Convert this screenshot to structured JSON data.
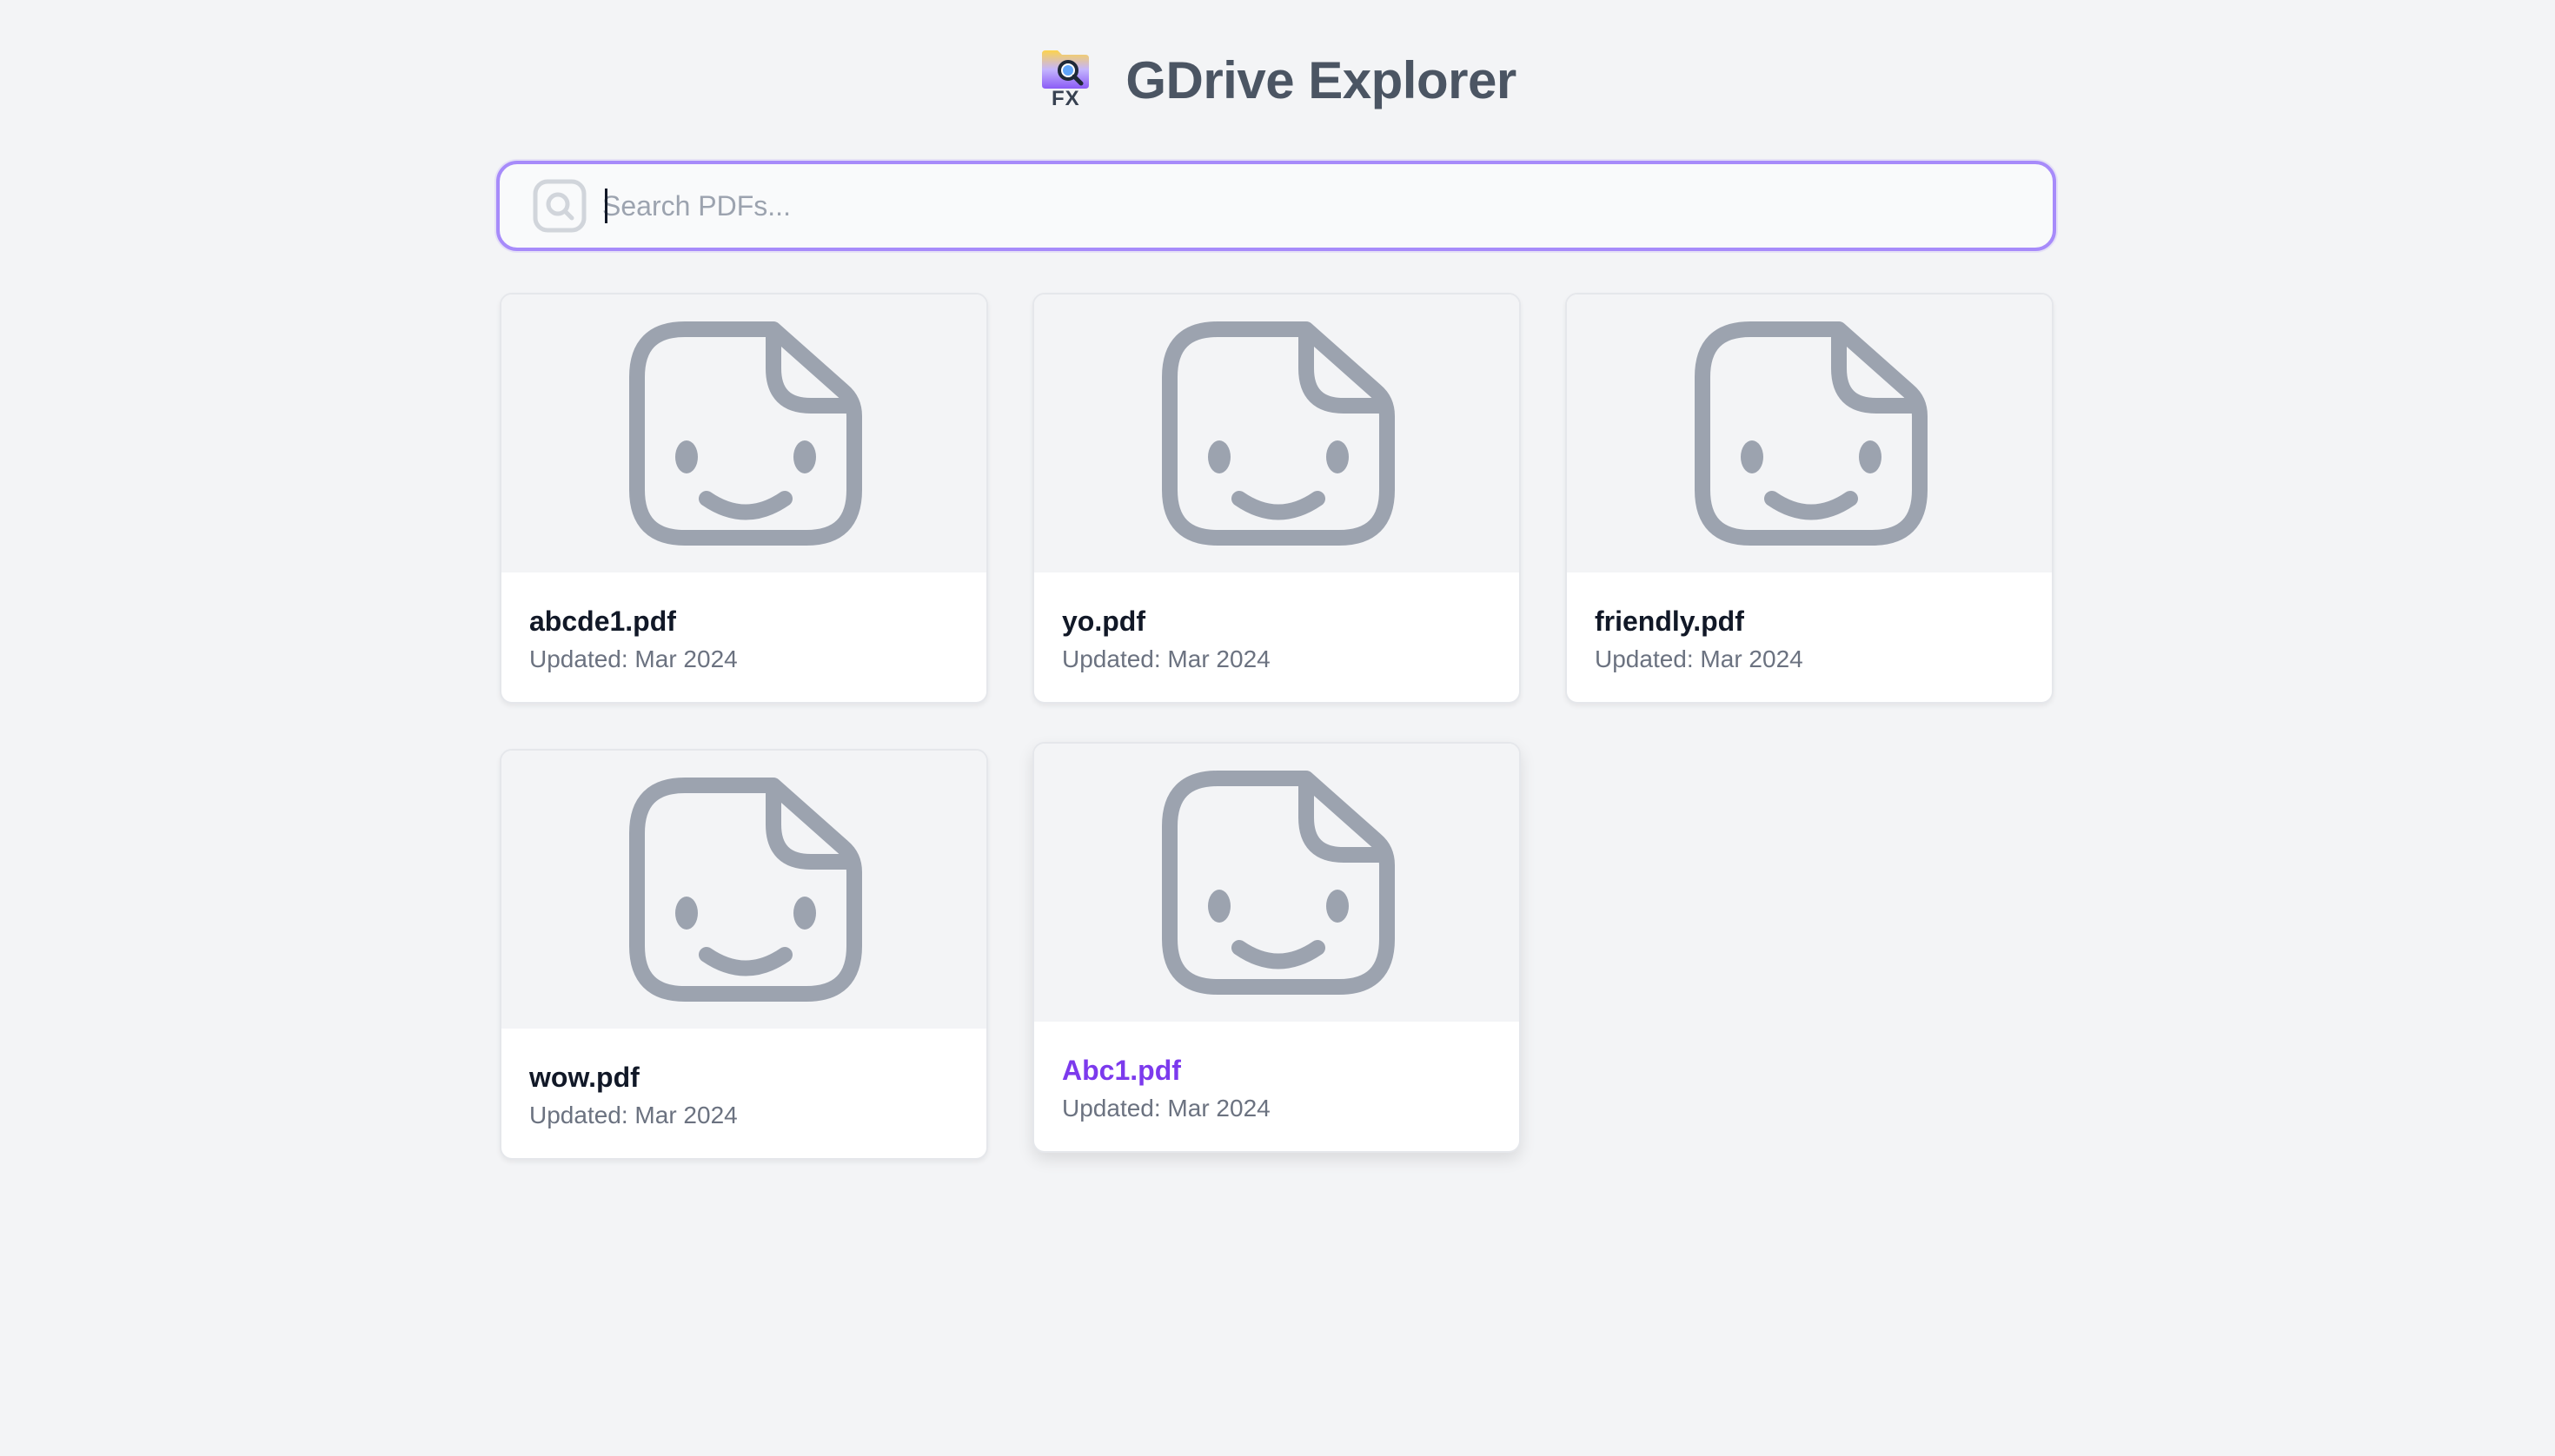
{
  "app": {
    "title": "GDrive Explorer",
    "logo_text": "FX",
    "logo_icon": "folder-magnifier-icon"
  },
  "search": {
    "placeholder": "Search PDFs...",
    "value": "",
    "icon": "search-icon"
  },
  "files": [
    {
      "name": "abcde1.pdf",
      "updated": "Updated: Mar 2024",
      "icon": "file-smile-icon"
    },
    {
      "name": "yo.pdf",
      "updated": "Updated: Mar 2024",
      "icon": "file-smile-icon"
    },
    {
      "name": "friendly.pdf",
      "updated": "Updated: Mar 2024",
      "icon": "file-smile-icon"
    },
    {
      "name": "wow.pdf",
      "updated": "Updated: Mar 2024",
      "icon": "file-smile-icon"
    },
    {
      "name": "Abc1.pdf",
      "updated": "Updated: Mar 2024",
      "icon": "file-smile-icon",
      "state": "hovered"
    }
  ],
  "colors": {
    "accent": "#7c3aed",
    "focus_border": "#a78bfa",
    "icon_gray": "#9ca3af",
    "background": "#f3f4f6"
  }
}
